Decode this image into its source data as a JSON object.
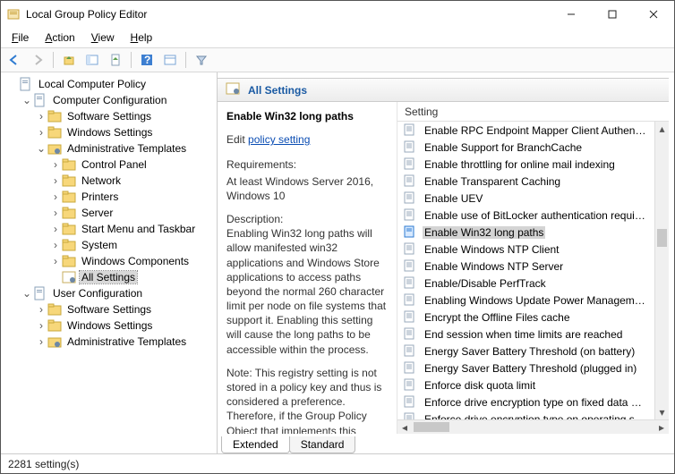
{
  "window": {
    "title": "Local Group Policy Editor"
  },
  "menus": [
    "File",
    "Action",
    "View",
    "Help"
  ],
  "tree": {
    "root": "Local Computer Policy",
    "cc": {
      "label": "Computer Configuration",
      "software": "Software Settings",
      "windows": "Windows Settings",
      "admin": {
        "label": "Administrative Templates",
        "children": [
          "Control Panel",
          "Network",
          "Printers",
          "Server",
          "Start Menu and Taskbar",
          "System",
          "Windows Components",
          "All Settings"
        ]
      }
    },
    "uc": {
      "label": "User Configuration",
      "software": "Software Settings",
      "windows": "Windows Settings",
      "admin": "Administrative Templates"
    }
  },
  "category_header": "All Settings",
  "detail": {
    "title": "Enable Win32 long paths",
    "edit_prefix": "Edit",
    "edit_link": "policy setting",
    "req_label": "Requirements:",
    "req_text": "At least Windows Server 2016, Windows 10",
    "desc_label": "Description:",
    "desc_text": "Enabling Win32 long paths will allow manifested win32 applications and Windows Store applications to access paths beyond the normal 260 character limit per node on file systems that support it.  Enabling this setting will cause the long paths to be accessible within the process.",
    "note_text": "Note:  This registry setting is not stored in a policy key and thus is considered a preference.  Therefore, if the Group Policy Object that implements this"
  },
  "list": {
    "header": "Setting",
    "items": [
      "Enable RPC Endpoint Mapper Client Authentication",
      "Enable Support for BranchCache",
      "Enable throttling for online mail indexing",
      "Enable Transparent Caching",
      "Enable UEV",
      "Enable use of BitLocker authentication requiring",
      "Enable Win32 long paths",
      "Enable Windows NTP Client",
      "Enable Windows NTP Server",
      "Enable/Disable PerfTrack",
      "Enabling Windows Update Power Management",
      "Encrypt the Offline Files cache",
      "End session when time limits are reached",
      "Energy Saver Battery Threshold (on battery)",
      "Energy Saver Battery Threshold (plugged in)",
      "Enforce disk quota limit",
      "Enforce drive encryption type on fixed data drives",
      "Enforce drive encryption type on operating system"
    ],
    "selected_index": 6
  },
  "tabs": {
    "extended": "Extended",
    "standard": "Standard"
  },
  "status": "2281 setting(s)"
}
